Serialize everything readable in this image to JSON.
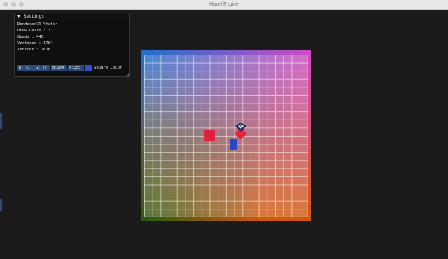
{
  "window": {
    "title": "Hazel Engine"
  },
  "settings": {
    "header": "Settings",
    "stats_title": "Renderer2D Stats:",
    "draw_calls": "Draw Calls : 3",
    "quads": "Quads : 446",
    "vertices": "Vertices : 1784",
    "indices": "Indices : 2676",
    "color": {
      "r": "R: 51",
      "g": "G: 77",
      "b": "B:204",
      "a": "A:255",
      "label": "Square Color",
      "swatch": "#334dcc"
    }
  },
  "scene": {
    "red_square_color": "#e0223f",
    "blue_square_color": "#2648c8",
    "rotated_square_color": "#e0223f",
    "sprite_icon": "checkerboard-sprite-icon"
  }
}
